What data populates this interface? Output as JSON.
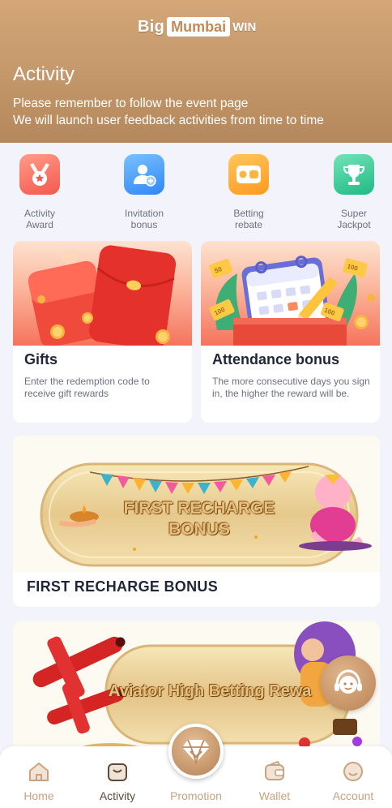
{
  "brand": {
    "part1": "Big",
    "part2": "Mumbai",
    "part3": "WIN"
  },
  "header": {
    "title": "Activity",
    "line1": "Please remember to follow the event page",
    "line2": "We will launch user feedback activities from time to time"
  },
  "categories": [
    {
      "line1": "Activity",
      "line2": "Award",
      "icon": "medal-icon",
      "color": "#f4584d"
    },
    {
      "line1": "Invitation",
      "line2": "bonus",
      "icon": "user-add-icon",
      "color": "#2f86f6"
    },
    {
      "line1": "Betting",
      "line2": "rebate",
      "icon": "wallet-icon",
      "color": "#ff9a1f"
    },
    {
      "line1": "Super",
      "line2": "Jackpot",
      "icon": "trophy-icon",
      "color": "#1fba85"
    }
  ],
  "cards": {
    "gifts": {
      "title": "Gifts",
      "desc": "Enter the redemption code to receive gift rewards"
    },
    "attendance": {
      "title": "Attendance bonus",
      "desc": "The more consecutive days you sign in, the higher the reward will be."
    },
    "att_stamps": {
      "a": "50",
      "b": "100",
      "c": "100",
      "d": "100"
    }
  },
  "banners": {
    "first_recharge": {
      "image_line1": "FIRST RECHARGE",
      "image_line2": "BONUS",
      "title": "FIRST RECHARGE BONUS"
    },
    "aviator": {
      "image_text": "Aviator High Betting Rewa"
    }
  },
  "tabbar": {
    "items": [
      {
        "label": "Home",
        "icon": "home-icon"
      },
      {
        "label": "Activity",
        "icon": "gift-bag-icon"
      },
      {
        "label": "Promotion",
        "icon": "diamond-icon"
      },
      {
        "label": "Wallet",
        "icon": "wallet-icon"
      },
      {
        "label": "Account",
        "icon": "account-icon"
      }
    ],
    "active": "Activity"
  },
  "colors": {
    "header_gold": "#c69a6d",
    "accent_brown": "#b5875c",
    "tab_inactive": "#c9a27f",
    "tab_active": "#5c4a3a"
  }
}
